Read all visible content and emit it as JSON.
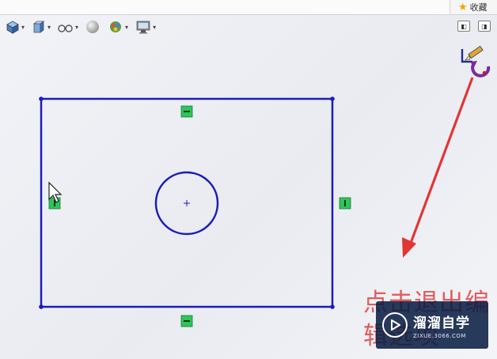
{
  "browser": {
    "favorites_label": "收藏"
  },
  "toolbar": {
    "items": [
      {
        "icon": "view-orientation-icon"
      },
      {
        "icon": "display-style-icon"
      },
      {
        "icon": "hide-show-items-icon"
      },
      {
        "icon": "edit-appearance-icon"
      },
      {
        "icon": "apply-scene-icon"
      },
      {
        "icon": "view-settings-icon"
      }
    ]
  },
  "window_controls": {
    "items": [
      {
        "icon": "tile-left-icon"
      },
      {
        "icon": "tile-right-icon"
      }
    ]
  },
  "sketch": {
    "exit_icon": "exit-sketch-icon",
    "shapes": [
      "rectangle",
      "circle"
    ],
    "relations": [
      "horizontal",
      "horizontal",
      "vertical",
      "vertical"
    ]
  },
  "annotation": {
    "text": "点击退出编辑选项",
    "color": "#e25b5b"
  },
  "watermark": {
    "title": "溜溜自学",
    "url": "ZIXUE.3066.COM"
  }
}
